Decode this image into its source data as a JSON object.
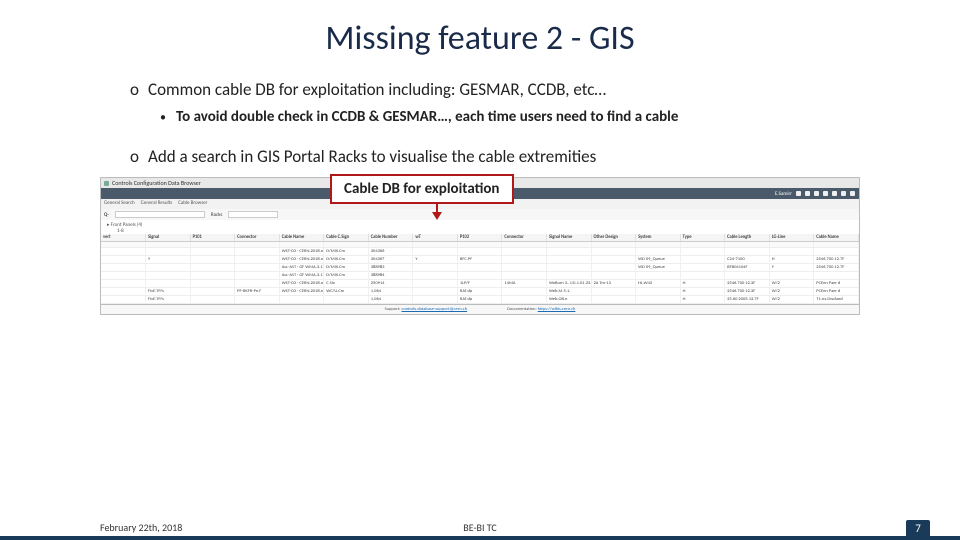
{
  "title": "Missing feature 2 - GIS",
  "bullets": {
    "b1": "Common cable DB for exploitation including: GESMAR, CCDB, etc…",
    "b1_sub": "To avoid double check in CCDB & GESMAR…, each time users need to find a cable",
    "b2": "Add a search in GIS Portal Racks to visualise the cable extremities"
  },
  "callout": "Cable DB for exploitation",
  "app": {
    "window_title": "Controls Configuration Data Browser",
    "toolbar_user": "E.Samirr",
    "tabs": [
      "General Search",
      "General Results",
      "Cable Browser"
    ],
    "search_q": "Q-",
    "racks": "Racks",
    "tree": "▸ Front Panels (4)",
    "tree_sub": "1-8",
    "footer_left_label": "Support:",
    "footer_left_link": "controls.database-support@cern.ch",
    "footer_right_label": "Documentation:",
    "footer_right_link": "https://wikis.cern.ch"
  },
  "columns": [
    "vert",
    "Signal",
    "P101",
    "Connector",
    "Cable Name",
    "Cable C.Sign",
    "Cable Number",
    "wT",
    "P102",
    "Connector",
    "Signal Name",
    "Other Design",
    "System",
    "Type",
    "Cable Length",
    "LG-Line",
    "Cable Name"
  ],
  "rows": [
    [
      "",
      "",
      "",
      "",
      "WST-CO · CERN.2018.n",
      "D/MIX.Cm",
      "304366",
      "",
      "",
      "",
      "",
      "",
      "",
      "",
      "",
      "",
      ""
    ],
    [
      "",
      "Y",
      "",
      "",
      "WST-CO · CERN.2018.n",
      "D/MIX.Cm",
      "304367",
      "Y",
      "BFC.PF",
      "",
      "",
      "",
      "WD 09_Queue",
      "",
      "C24-7100",
      "H",
      "2546.700 12.7F"
    ],
    [
      "",
      "",
      "",
      "",
      "Asc-AST · GF WMA.3.12.F",
      "D/MIX.Cm",
      "388983",
      "",
      "",
      "",
      "",
      "",
      "WD 09_Queue",
      "",
      "BFB04104F",
      "Y",
      "2546.700 12.7F"
    ],
    [
      "",
      "",
      "",
      "",
      "Asc-AST · GF WMA.3.12.F",
      "D/MIX.Cm",
      "388984",
      "",
      "",
      "",
      "",
      "",
      "",
      "",
      "",
      "",
      ""
    ],
    [
      "",
      "",
      "",
      "",
      "WST-CO · CERN.2018.n",
      "C.Six",
      "250914",
      "",
      "1LP/F",
      "14MA",
      "WeBurn 3.. LSI.1.01.25..",
      "2A Tm-13",
      "HL.W43",
      "H",
      "2546.700 12.2F",
      "W/2",
      "PCEen Paer d"
    ],
    [
      "",
      "FivE.TP/s",
      "",
      "PF-RKFR-Pe.F",
      "WST-CO · CERN.2018.n",
      "WC/U.Cm",
      "1,064",
      "",
      "RAT.dp",
      "",
      "Web.M.5.1.",
      "",
      "",
      "H",
      "2546.700 12.2F",
      "W/2",
      "PCEen Paer d"
    ],
    [
      "",
      "FivE.TP/s",
      "",
      "",
      "",
      "",
      "1,064",
      "",
      "RAT.dp",
      "",
      "Web.OB.n",
      "",
      "",
      "H",
      "25.60 2005.12.7F",
      "W/2",
      "T1.na Dwdand"
    ]
  ],
  "footer": {
    "date": "February 22th, 2018",
    "center": "BE-BI TC",
    "page": "7"
  }
}
